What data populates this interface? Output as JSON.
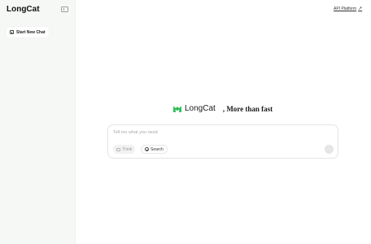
{
  "sidebar": {
    "brand": "LongCat",
    "new_chat_label": "Start New Chat"
  },
  "header": {
    "api_link": "API Platform",
    "api_icon": "arrow-up-right-icon"
  },
  "hero": {
    "logo_icon": "longcat-logo-icon",
    "name": "LongCat",
    "tagline": ", More than fast",
    "logo_color": "#2fbf5a"
  },
  "composer": {
    "placeholder": "Tell me what you need",
    "chips": [
      {
        "label": "Think",
        "icon": "think-icon"
      },
      {
        "label": "Search",
        "icon": "globe-icon"
      }
    ],
    "send_icon": "arrow-up-icon"
  }
}
